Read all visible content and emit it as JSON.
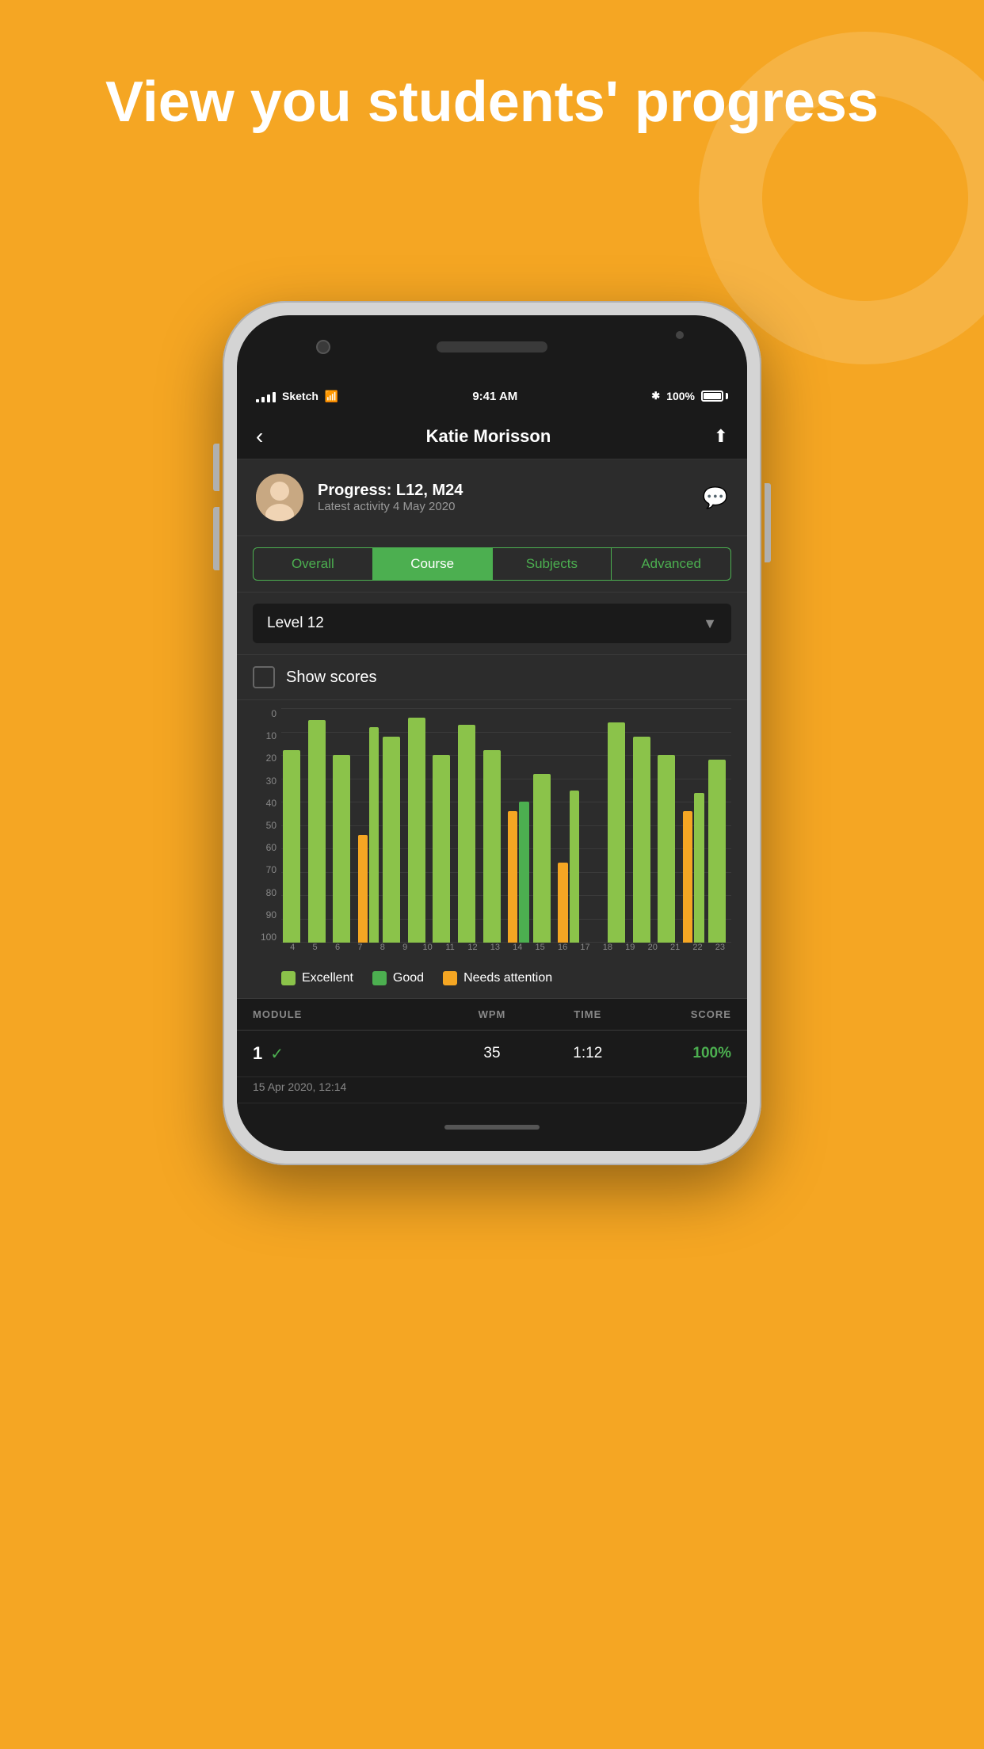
{
  "page": {
    "bg_color": "#F5A623",
    "title": "View you students' progress"
  },
  "status_bar": {
    "carrier": "Sketch",
    "time": "9:41 AM",
    "bluetooth": "✱",
    "battery_percent": "100%"
  },
  "nav": {
    "back_label": "‹",
    "title": "Katie Morisson",
    "share_icon": "⬆"
  },
  "profile": {
    "progress_title": "Progress: L12, M24",
    "activity_date": "Latest activity 4 May 2020"
  },
  "tabs": [
    {
      "label": "Overall",
      "active": false
    },
    {
      "label": "Course",
      "active": true
    },
    {
      "label": "Subjects",
      "active": false
    },
    {
      "label": "Advanced",
      "active": false
    }
  ],
  "dropdown": {
    "value": "Level 12"
  },
  "show_scores": {
    "label": "Show scores"
  },
  "chart": {
    "y_labels": [
      "100",
      "90",
      "80",
      "70",
      "60",
      "50",
      "40",
      "30",
      "20",
      "10",
      "0"
    ],
    "x_labels": [
      "4",
      "5",
      "6",
      "7",
      "8",
      "9",
      "10",
      "11",
      "12",
      "13",
      "14",
      "15",
      "16",
      "17",
      "18",
      "19",
      "20",
      "21",
      "22",
      "23"
    ],
    "bars": [
      {
        "excellent": 82,
        "good": 0,
        "attention": 0
      },
      {
        "excellent": 95,
        "good": 0,
        "attention": 0
      },
      {
        "excellent": 80,
        "good": 0,
        "attention": 0
      },
      {
        "excellent": 92,
        "good": 0,
        "attention": 46
      },
      {
        "excellent": 88,
        "good": 0,
        "attention": 0
      },
      {
        "excellent": 96,
        "good": 0,
        "attention": 0
      },
      {
        "excellent": 80,
        "good": 0,
        "attention": 0
      },
      {
        "excellent": 93,
        "good": 0,
        "attention": 0
      },
      {
        "excellent": 82,
        "good": 0,
        "attention": 0
      },
      {
        "excellent": 0,
        "good": 60,
        "attention": 56
      },
      {
        "excellent": 72,
        "good": 0,
        "attention": 0
      },
      {
        "excellent": 65,
        "good": 0,
        "attention": 34
      },
      {
        "excellent": 0,
        "good": 0,
        "attention": 0
      },
      {
        "excellent": 94,
        "good": 0,
        "attention": 0
      },
      {
        "excellent": 88,
        "good": 0,
        "attention": 0
      },
      {
        "excellent": 80,
        "good": 0,
        "attention": 0
      },
      {
        "excellent": 64,
        "good": 0,
        "attention": 56
      },
      {
        "excellent": 78,
        "good": 0,
        "attention": 0
      }
    ]
  },
  "legend": [
    {
      "label": "Excellent",
      "color": "#8BC34A"
    },
    {
      "label": "Good",
      "color": "#4CAF50"
    },
    {
      "label": "Needs attention",
      "color": "#F5A623"
    }
  ],
  "table": {
    "headers": {
      "module": "MODULE",
      "wpm": "WPM",
      "time": "TIME",
      "score": "SCORE"
    },
    "rows": [
      {
        "module_num": "1",
        "checked": true,
        "wpm": "35",
        "time": "1:12",
        "score": "100%",
        "score_color": "#4CAF50",
        "subtitle": "15 Apr 2020, 12:14"
      }
    ]
  }
}
